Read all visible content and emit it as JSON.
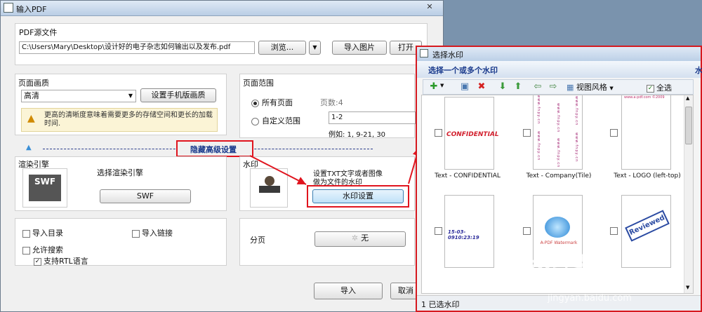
{
  "main_dialog": {
    "title": "输入PDF",
    "close": "✕",
    "pdf_source": {
      "label": "PDF源文件",
      "path": "C:\\Users\\Mary\\Desktop\\设计好的电子杂志如何输出以及发布.pdf",
      "browse": "浏览...",
      "import_images": "导入图片",
      "open": "打开"
    },
    "page_quality": {
      "label": "页面画质",
      "selected": "高清",
      "mobile_button": "设置手机版画质",
      "hint": "更高的清晰度意味着需要更多的存储空间和更长的加载时间."
    },
    "page_range": {
      "label": "页面范围",
      "all_pages": "所有页面",
      "page_count": "页数:4",
      "custom_range": "自定义范围",
      "custom_value": "1-2",
      "example": "例如: 1, 9-21, 30"
    },
    "advanced_toggle": "隐藏高级设置",
    "render_engine": {
      "label": "渲染引擎",
      "choose": "选择渲染引擎",
      "engine_button": "SWF",
      "icon_text": "SWF"
    },
    "watermark": {
      "label": "水印",
      "desc_line1": "设置TXT文字或者图像",
      "desc_line2": "做为文件的水印",
      "button": "水印设置"
    },
    "options": {
      "import_toc": "导入目录",
      "import_links": "导入链接",
      "allow_search": "允许搜索",
      "rtl_support": "支持RTL语言"
    },
    "pagination": {
      "label": "分页",
      "button": "无"
    },
    "import_button": "导入",
    "cancel_button": "取消"
  },
  "watermark_dialog": {
    "title": "选择水印",
    "header": "选择一个或多个水印",
    "header_right": "水",
    "view_style": "视图风格",
    "select_all": "全选",
    "items": [
      {
        "caption": "Text - CONFIDENTIAL",
        "preview_text": "CONFIDENTIAL"
      },
      {
        "caption": "Text - Company(Tile)",
        "preview_text": "www.fnpy.cn"
      },
      {
        "caption": "Text - LOGO (left-top)",
        "preview_text": "www.a-pdf.com ©2009"
      },
      {
        "caption": "",
        "preview_text": "15-03-0910:23:19"
      },
      {
        "caption": "",
        "preview_text": "A-PDF Watermark"
      },
      {
        "caption": "",
        "preview_text": "Reviewed"
      }
    ],
    "status": "1 已选水印"
  },
  "watermark_site": {
    "brand": "Bai经验",
    "url": "jingyan.baidu.com"
  },
  "colors": {
    "highlight_red": "#e0141e",
    "title_blue": "#1a3a8c",
    "confidential_red": "#d2202e"
  }
}
